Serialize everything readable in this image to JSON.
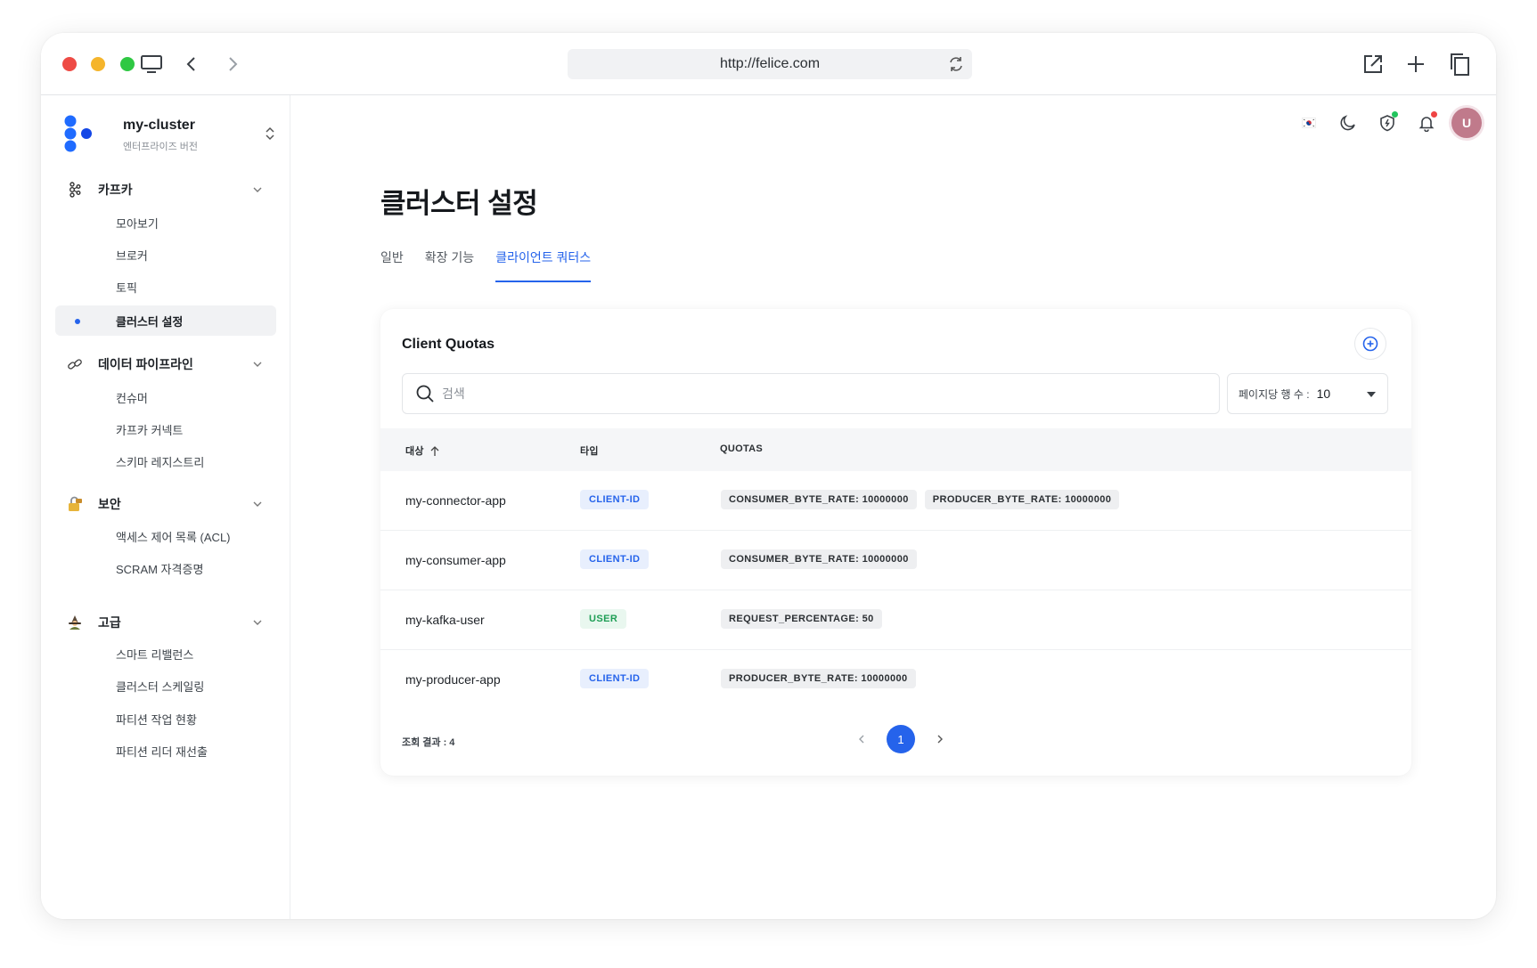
{
  "browser": {
    "url": "http://felice.com"
  },
  "cluster": {
    "name": "my-cluster",
    "edition": "엔터프라이즈 버전"
  },
  "sidebar": {
    "groups": [
      {
        "label": "카프카",
        "icon": "kafka-icon",
        "items": [
          "모아보기",
          "브로커",
          "토픽",
          "클러스터 설정"
        ]
      },
      {
        "label": "데이터 파이프라인",
        "icon": "link-icon",
        "items": [
          "컨슈머",
          "카프카 커넥트",
          "스키마 레지스트리"
        ]
      },
      {
        "label": "보안",
        "icon": "lock-icon",
        "items": [
          "액세스 제어 목록 (ACL)",
          "SCRAM 자격증명"
        ]
      },
      {
        "label": "고급",
        "icon": "wizard-icon",
        "items": [
          "스마트 리밸런스",
          "클러스터 스케일링",
          "파티션 작업 현황",
          "파티션 리더 재선출"
        ]
      }
    ],
    "active_item": "클러스터 설정"
  },
  "header": {
    "avatar_initial": "U",
    "icons": [
      "korea-flag-icon",
      "moon-icon",
      "shield-icon",
      "bell-icon"
    ]
  },
  "page": {
    "title": "클러스터 설정",
    "tabs": [
      "일반",
      "확장 기능",
      "클라이언트 쿼터스"
    ],
    "active_tab": "클라이언트 쿼터스"
  },
  "card": {
    "title": "Client Quotas",
    "search_placeholder": "검색",
    "per_page_label": "페이지당 행 수 :",
    "per_page_value": "10",
    "columns": [
      "대상",
      "타입",
      "QUOTAS"
    ],
    "rows": [
      {
        "target": "my-connector-app",
        "type": "CLIENT-ID",
        "quotas": [
          "CONSUMER_BYTE_RATE: 10000000",
          "PRODUCER_BYTE_RATE: 10000000"
        ]
      },
      {
        "target": "my-consumer-app",
        "type": "CLIENT-ID",
        "quotas": [
          "CONSUMER_BYTE_RATE: 10000000"
        ]
      },
      {
        "target": "my-kafka-user",
        "type": "USER",
        "quotas": [
          "REQUEST_PERCENTAGE: 50"
        ]
      },
      {
        "target": "my-producer-app",
        "type": "CLIENT-ID",
        "quotas": [
          "PRODUCER_BYTE_RATE: 10000000"
        ]
      }
    ],
    "result_count": "조회 결과 : 4",
    "current_page": "1"
  },
  "colors": {
    "accent": "#2563eb",
    "user_badge": "#1e9e55",
    "shield_badge": "#22c55e",
    "bell_badge": "#ef4444"
  }
}
